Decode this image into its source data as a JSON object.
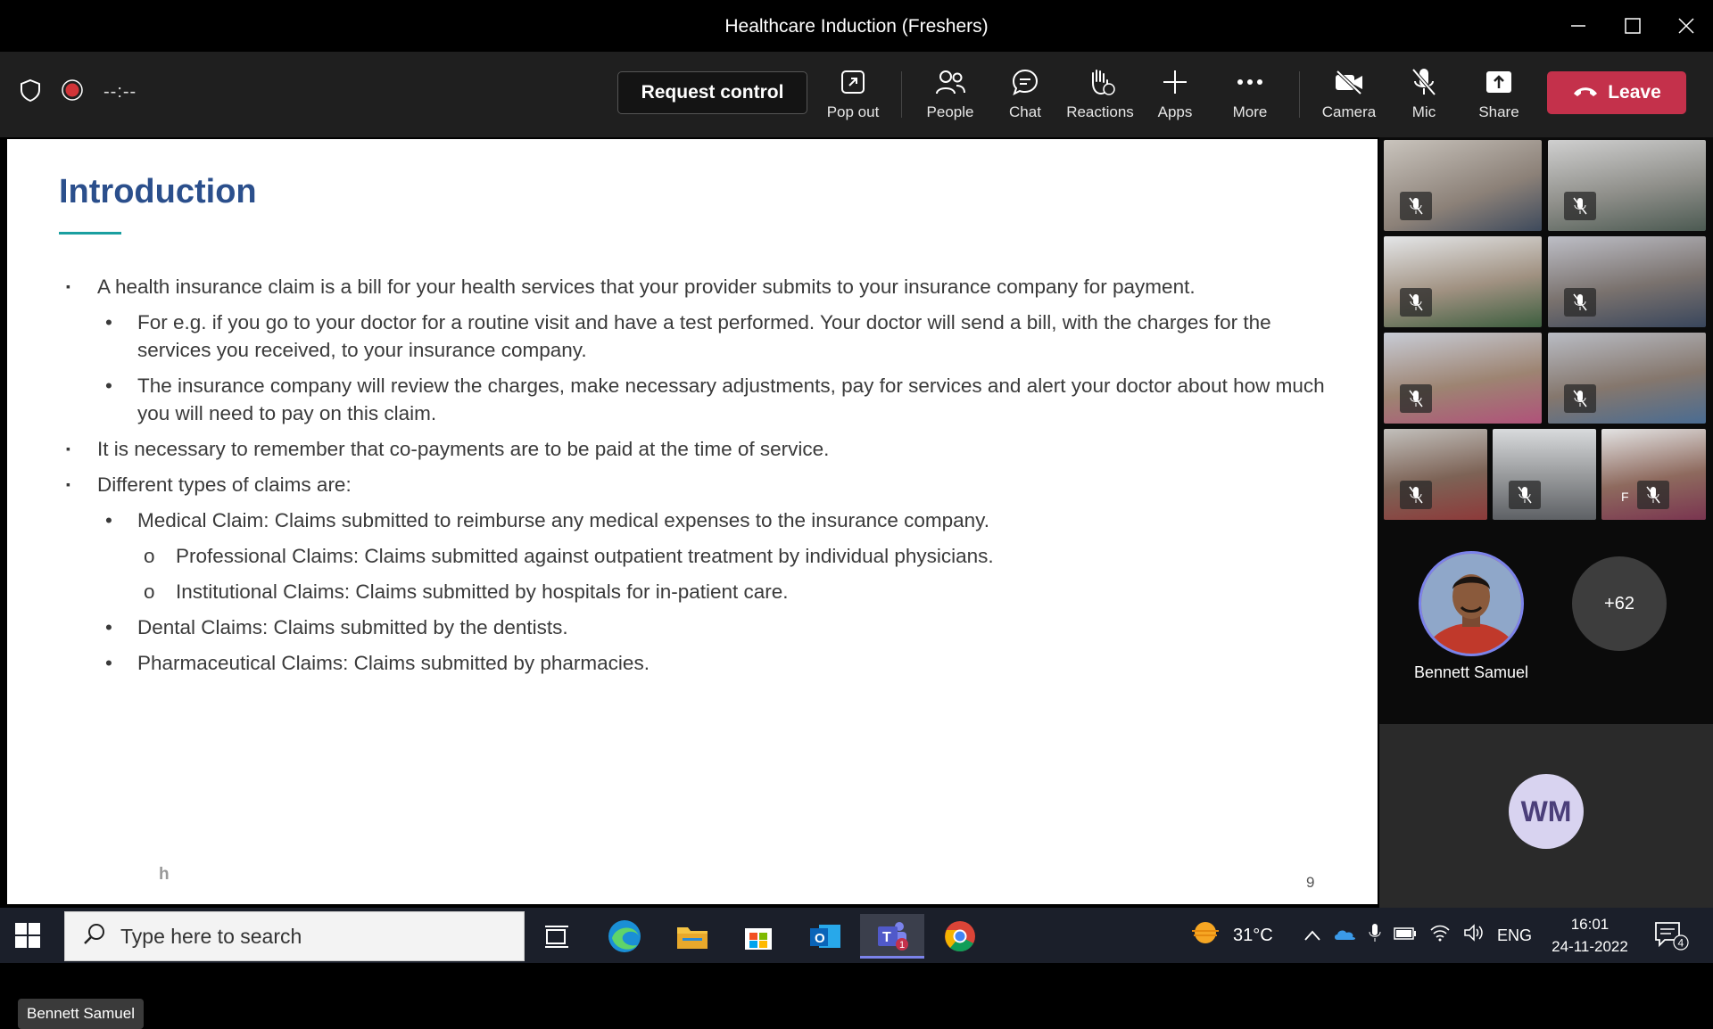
{
  "window": {
    "title": "Healthcare Induction (Freshers)"
  },
  "toolbar": {
    "timer": "--:--",
    "request_control": "Request control",
    "pop_out": "Pop out",
    "people": "People",
    "chat": "Chat",
    "reactions": "Reactions",
    "apps": "Apps",
    "more": "More",
    "camera": "Camera",
    "mic": "Mic",
    "share": "Share",
    "leave": "Leave"
  },
  "slide": {
    "title": "Introduction",
    "bullets": [
      {
        "level": 1,
        "text": "A health insurance claim is a bill for your health services that your provider submits to your insurance company for payment."
      },
      {
        "level": 2,
        "text": "For e.g. if you go to your doctor for a routine visit and have a test performed. Your doctor will send a bill, with the charges for the services you received, to your insurance company."
      },
      {
        "level": 2,
        "text": "The insurance company will review the charges, make necessary adjustments, pay for services and alert your doctor about how much you will need to pay on this claim."
      },
      {
        "level": 1,
        "text": "It is necessary to remember that co-payments are to be paid at the time of service."
      },
      {
        "level": 1,
        "text": "Different types of claims are:"
      },
      {
        "level": 2,
        "text": "Medical Claim: Claims submitted to reimburse any medical expenses to the insurance company."
      },
      {
        "level": 3,
        "text": "Professional Claims: Claims submitted against outpatient treatment by individual physicians."
      },
      {
        "level": 3,
        "text": "Institutional Claims: Claims submitted by hospitals for in-patient care."
      },
      {
        "level": 2,
        "text": "Dental Claims: Claims submitted by the dentists."
      },
      {
        "level": 2,
        "text": "Pharmaceutical Claims: Claims submitted by pharmacies."
      }
    ],
    "page_number": "9",
    "footer_faded": "h",
    "presenter_tag": "Bennett Samuel"
  },
  "participants": {
    "featured_name": "Bennett Samuel",
    "more_count": "+62",
    "wm_initials": "WM",
    "tile_letter": "F"
  },
  "taskbar": {
    "search_placeholder": "Type here to search",
    "weather": "31°C",
    "language": "ENG",
    "time": "16:01",
    "date": "24-11-2022",
    "teams_badge": "1",
    "notif_count": "4"
  },
  "colors": {
    "leave": "#c4314b",
    "accent": "#7b83eb",
    "slide_title": "#2b4f8c"
  }
}
